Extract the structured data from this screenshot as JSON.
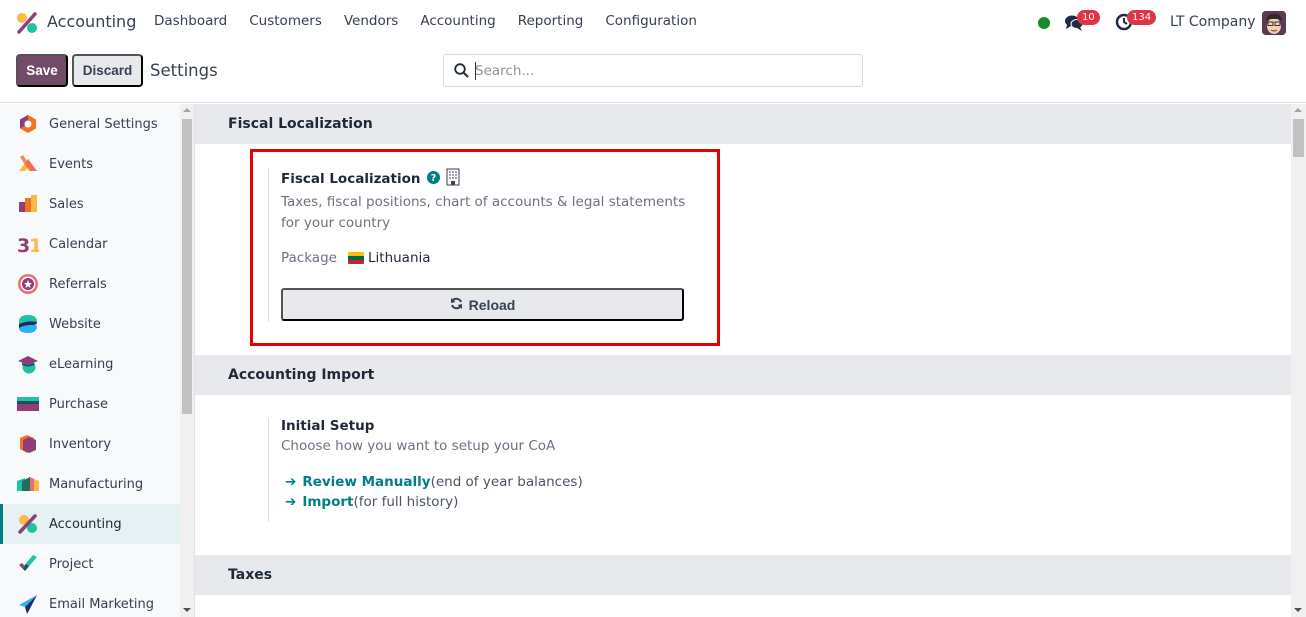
{
  "topbar": {
    "app_name": "Accounting",
    "menu": [
      "Dashboard",
      "Customers",
      "Vendors",
      "Accounting",
      "Reporting",
      "Configuration"
    ],
    "messages_count": "10",
    "activities_count": "134",
    "company": "LT Company",
    "presence_color": "#198a29"
  },
  "controlbar": {
    "save_label": "Save",
    "discard_label": "Discard",
    "breadcrumb": "Settings",
    "search_placeholder": "Search...",
    "search_value": ""
  },
  "sidebar": {
    "items": [
      {
        "label": "General Settings",
        "icon": "general-settings-icon"
      },
      {
        "label": "Events",
        "icon": "events-icon"
      },
      {
        "label": "Sales",
        "icon": "sales-icon"
      },
      {
        "label": "Calendar",
        "icon": "calendar-icon"
      },
      {
        "label": "Referrals",
        "icon": "referrals-icon"
      },
      {
        "label": "Website",
        "icon": "website-icon"
      },
      {
        "label": "eLearning",
        "icon": "elearning-icon"
      },
      {
        "label": "Purchase",
        "icon": "purchase-icon"
      },
      {
        "label": "Inventory",
        "icon": "inventory-icon"
      },
      {
        "label": "Manufacturing",
        "icon": "manufacturing-icon"
      },
      {
        "label": "Accounting",
        "icon": "accounting-icon",
        "active": true
      },
      {
        "label": "Project",
        "icon": "project-icon"
      },
      {
        "label": "Email Marketing",
        "icon": "email-marketing-icon"
      }
    ]
  },
  "main": {
    "sections": [
      {
        "title": "Fiscal Localization",
        "setting": {
          "title": "Fiscal Localization",
          "description": "Taxes, fiscal positions, chart of accounts & legal statements for your country",
          "package_label": "Package",
          "package_value": "Lithuania",
          "reload_label": "Reload"
        }
      },
      {
        "title": "Accounting Import",
        "setting": {
          "title": "Initial Setup",
          "description": "Choose how you want to setup your CoA",
          "links": [
            {
              "label": "Review Manually",
              "note": "(end of year balances)"
            },
            {
              "label": "Import",
              "note": "(for full history)"
            }
          ]
        }
      },
      {
        "title": "Taxes"
      }
    ]
  },
  "colors": {
    "brand": "#714b67",
    "accent": "#017e84",
    "highlight_border": "#e60000",
    "badge": "#dc3545"
  }
}
